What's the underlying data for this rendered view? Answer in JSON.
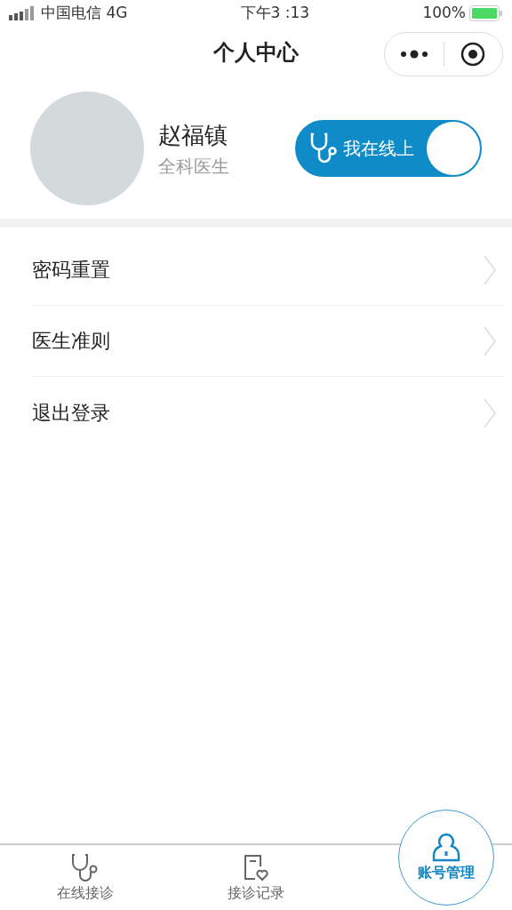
{
  "status_bar": {
    "carrier": "中国电信 4G",
    "time": "下午3 :13",
    "battery": "100%"
  },
  "header": {
    "title": "个人中心"
  },
  "profile": {
    "name": "赵福镇",
    "role": "全科医生",
    "online_toggle": {
      "label": "我在线上",
      "on": true
    }
  },
  "menu": [
    {
      "label": "密码重置"
    },
    {
      "label": "医生准则"
    },
    {
      "label": "退出登录"
    }
  ],
  "tab_bar": [
    {
      "label": "在线接诊",
      "selected": false
    },
    {
      "label": "接诊记录",
      "selected": false
    },
    {
      "label": "账号管理",
      "selected": true
    }
  ]
}
